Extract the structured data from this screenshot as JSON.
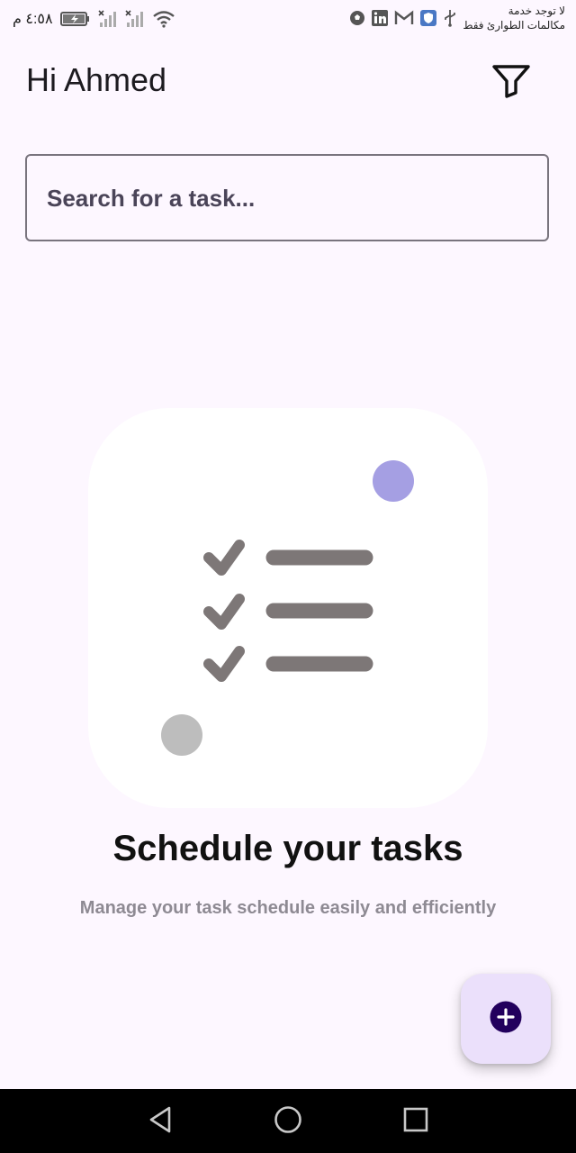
{
  "status_bar": {
    "time": "٤:٥٨ م",
    "carrier_line1": "لا توجد خدمة",
    "carrier_line2": "مكالمات الطوارئ فقط",
    "icons": [
      "battery-charging-icon",
      "signal-no-service-icon",
      "signal-no-service-icon",
      "wifi-icon",
      "soccer-app-icon",
      "linkedin-icon",
      "gmail-icon",
      "shield-app-icon",
      "usb-icon"
    ]
  },
  "header": {
    "greeting": "Hi Ahmed",
    "filter_icon": "filter-icon"
  },
  "search": {
    "placeholder": "Search for a task...",
    "value": ""
  },
  "empty_state": {
    "illustration_icon": "task-checklist-icon",
    "title": "Schedule your tasks",
    "subtitle": "Manage your task schedule easily and efficiently"
  },
  "fab": {
    "icon": "add-circle-icon"
  },
  "nav_bar": {
    "back_icon": "back-triangle-icon",
    "home_icon": "home-circle-icon",
    "recents_icon": "recents-square-icon"
  },
  "colors": {
    "background": "#fdf7ff",
    "fab_background": "#ebe0fb",
    "fab_icon": "#22005d",
    "accent_dot": "#a59fe3",
    "grey_dot": "#bdbdbd",
    "checklist": "#7d7777",
    "nav_bar": "#000000"
  }
}
